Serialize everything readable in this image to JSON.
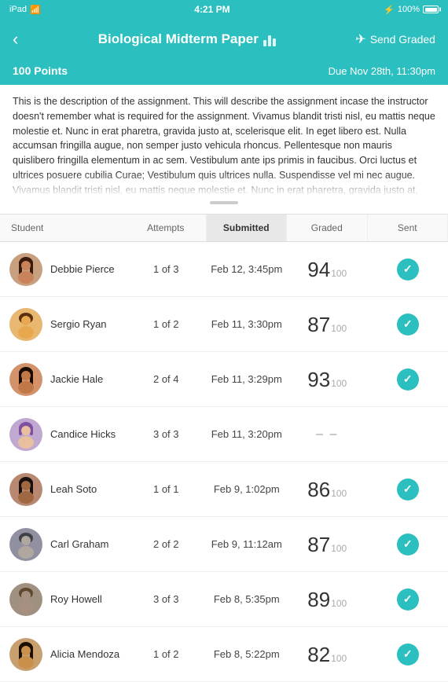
{
  "status_bar": {
    "left": "iPad",
    "time": "4:21 PM",
    "battery": "100%"
  },
  "header": {
    "back_label": "‹",
    "title": "Biological Midterm Paper",
    "send_label": "Send Graded"
  },
  "assignment": {
    "points": "100 Points",
    "due": "Due Nov 28th, 11:30pm",
    "description": "This is the description of the assignment. This will describe the assignment incase the instructor doesn't remember what is required for the assignment. Vivamus blandit tristi nisl, eu mattis neque molestie et. Nunc in erat pharetra, gravida justo at, scelerisque elit. In eget libero est. Nulla accumsan fringilla augue, non semper justo vehicula rhoncus. Pellentesque non mauris quislibero fringilla elementum in ac sem. Vestibulum ante ips primis in faucibus. Orci luctus et ultrices posuere cubilia Curae; Vestibulum quis ultrices nulla. Suspendisse vel mi nec augue. Vivamus blandit tristi nisl, eu mattis neque molestie et. Nunc in erat pharetra, gravida justo at, scelerisque elit. nisl, eu mattis neque molestie."
  },
  "table": {
    "headers": [
      "Student",
      "Attempts",
      "Submitted",
      "Graded",
      "Sent"
    ],
    "active_header": "Submitted",
    "rows": [
      {
        "name": "Debbie Pierce",
        "attempts": "1 of 3",
        "submitted": "Feb 12, 3:45pm",
        "grade": "94",
        "sent": true,
        "dash": false,
        "avatar_color": "#c8a080",
        "avatar_type": "female1"
      },
      {
        "name": "Sergio Ryan",
        "attempts": "1 of 2",
        "submitted": "Feb 11, 3:30pm",
        "grade": "87",
        "sent": true,
        "dash": false,
        "avatar_color": "#e8b870",
        "avatar_type": "male1"
      },
      {
        "name": "Jackie Hale",
        "attempts": "2 of 4",
        "submitted": "Feb 11, 3:29pm",
        "grade": "93",
        "sent": true,
        "dash": false,
        "avatar_color": "#d4926a",
        "avatar_type": "female2"
      },
      {
        "name": "Candice Hicks",
        "attempts": "3 of 3",
        "submitted": "Feb 11, 3:20pm",
        "grade": "",
        "sent": false,
        "dash": true,
        "avatar_color": "#c0a8d0",
        "avatar_type": "female3"
      },
      {
        "name": "Leah Soto",
        "attempts": "1 of 1",
        "submitted": "Feb 9, 1:02pm",
        "grade": "86",
        "sent": true,
        "dash": false,
        "avatar_color": "#b88870",
        "avatar_type": "female4"
      },
      {
        "name": "Carl Graham",
        "attempts": "2 of 2",
        "submitted": "Feb 9, 11:12am",
        "grade": "87",
        "sent": true,
        "dash": false,
        "avatar_color": "#9090a0",
        "avatar_type": "male2"
      },
      {
        "name": "Roy Howell",
        "attempts": "3 of 3",
        "submitted": "Feb 8, 5:35pm",
        "grade": "89",
        "sent": true,
        "dash": false,
        "avatar_color": "#a09080",
        "avatar_type": "male3"
      },
      {
        "name": "Alicia Mendoza",
        "attempts": "1 of 2",
        "submitted": "Feb 8, 5:22pm",
        "grade": "82",
        "sent": true,
        "dash": false,
        "avatar_color": "#c8a070",
        "avatar_type": "female5"
      }
    ]
  }
}
